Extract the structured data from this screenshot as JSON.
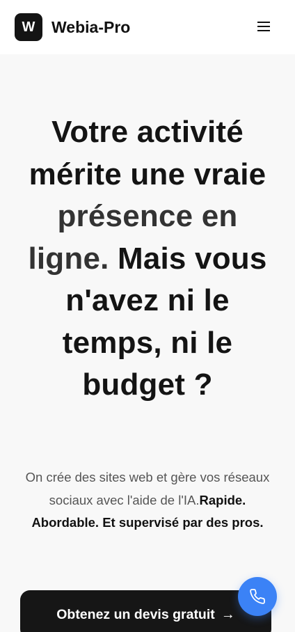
{
  "header": {
    "logo_letter": "W",
    "brand": "Webia-Pro"
  },
  "hero": {
    "headline": {
      "part1": "Votre activité mérite une vraie ",
      "accent": "présence en ligne.",
      "part2": " Mais vous n'avez ni le temps, ni le budget ?"
    },
    "subtext": {
      "plain": "On crée des sites web et gère vos réseaux sociaux avec l'aide de l'IA.",
      "bold": "Rapide. Abordable. Et supervisé par des pros."
    },
    "cta_label": "Obtenez un devis gratuit",
    "cta_arrow": "→"
  },
  "icons": {
    "menu": "hamburger-icon",
    "phone": "phone-icon"
  },
  "colors": {
    "header_bg": "#ffffff",
    "page_bg": "#f8f8f8",
    "dark": "#141414",
    "accent_blue": "#3b82f6"
  }
}
